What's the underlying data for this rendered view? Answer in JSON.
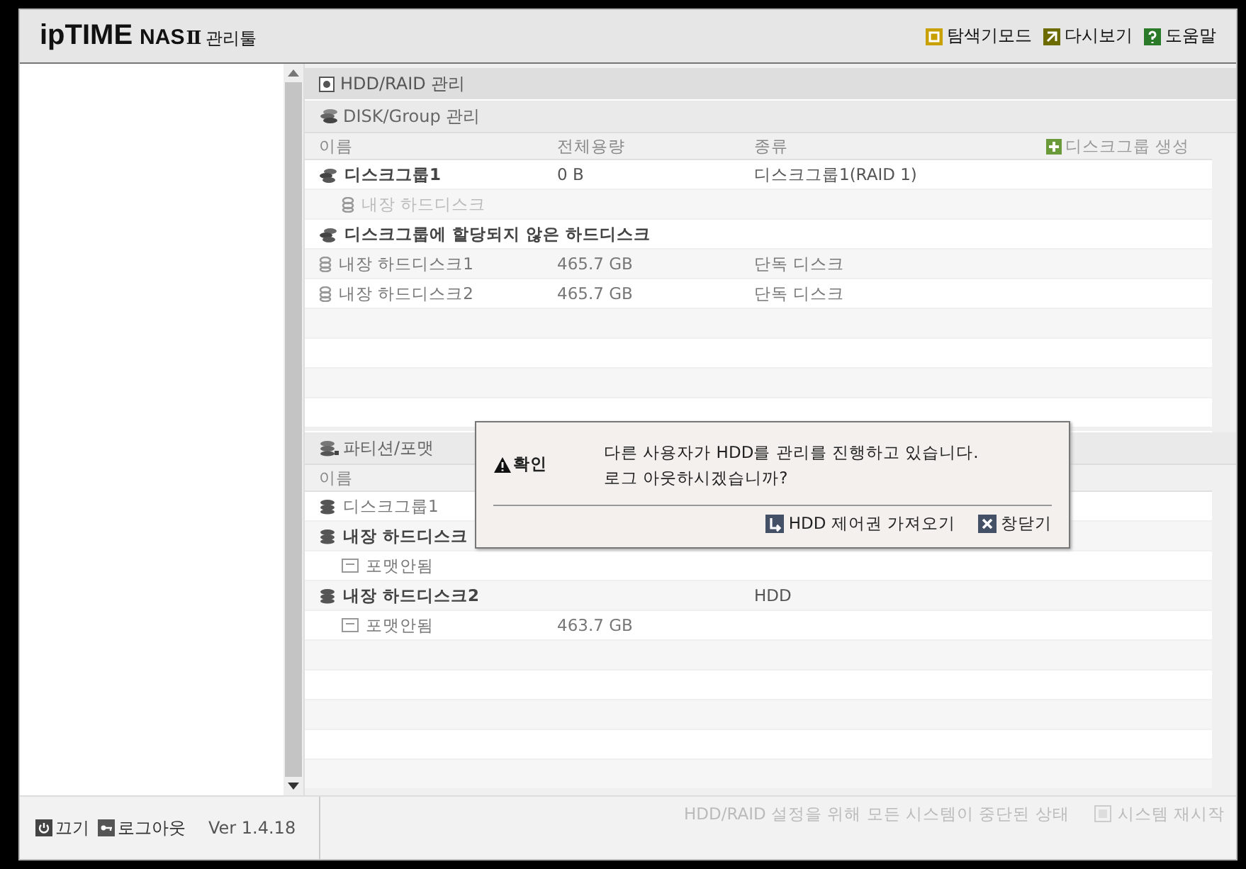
{
  "header": {
    "logo_brand": "ipTIME",
    "logo_product": "NAS",
    "logo_suffix": "Ⅱ",
    "logo_tool": "관리툴",
    "links": [
      {
        "kind": "explore",
        "label": "탐색기모드"
      },
      {
        "kind": "refresh",
        "label": "다시보기"
      },
      {
        "kind": "help",
        "label": "도움말"
      }
    ]
  },
  "panel_title": "HDD/RAID 관리",
  "disk_section": {
    "title": "DISK/Group 관리",
    "columns": [
      "이름",
      "전체용량",
      "종류"
    ],
    "create_button": "디스크그룹 생성",
    "rows": [
      {
        "kind": "group",
        "name": "디스크그룹1",
        "size": "0 B",
        "type": "디스크그룹1(RAID 1)"
      },
      {
        "kind": "member",
        "name": "내장 하드디스크"
      },
      {
        "kind": "group",
        "name": "디스크그룹에 할당되지 않은 하드디스크"
      },
      {
        "kind": "disk",
        "name": "내장 하드디스크1",
        "size": "465.7 GB",
        "type": "단독 디스크"
      },
      {
        "kind": "disk",
        "name": "내장 하드디스크2",
        "size": "465.7 GB",
        "type": "단독 디스크"
      }
    ]
  },
  "partition_section": {
    "title": "파티션/포맷",
    "columns": [
      "이름"
    ],
    "rows": [
      {
        "kind": "plain",
        "name": "디스크그룹1"
      },
      {
        "kind": "volume",
        "name": "내장 하드디스크"
      },
      {
        "kind": "partition",
        "name": "포맷안됨"
      },
      {
        "kind": "volume",
        "name": "내장 하드디스크2",
        "type": "HDD"
      },
      {
        "kind": "partition",
        "name": "포맷안됨",
        "size": "463.7 GB"
      }
    ]
  },
  "status": {
    "message": "HDD/RAID 설정을 위해 모든 시스템이 중단된 상태",
    "restart": "시스템 재시작"
  },
  "footer": {
    "power": "끄기",
    "logout": "로그아웃",
    "version": "Ver 1.4.18"
  },
  "dialog": {
    "title": "확인",
    "message": "다른 사용자가 HDD를 관리를 진행하고 있습니다.\n로그 아웃하시겠습니까?",
    "buttons": [
      {
        "kind": "take",
        "label": "HDD 제어권 가져오기"
      },
      {
        "kind": "close",
        "label": "창닫기"
      }
    ]
  }
}
